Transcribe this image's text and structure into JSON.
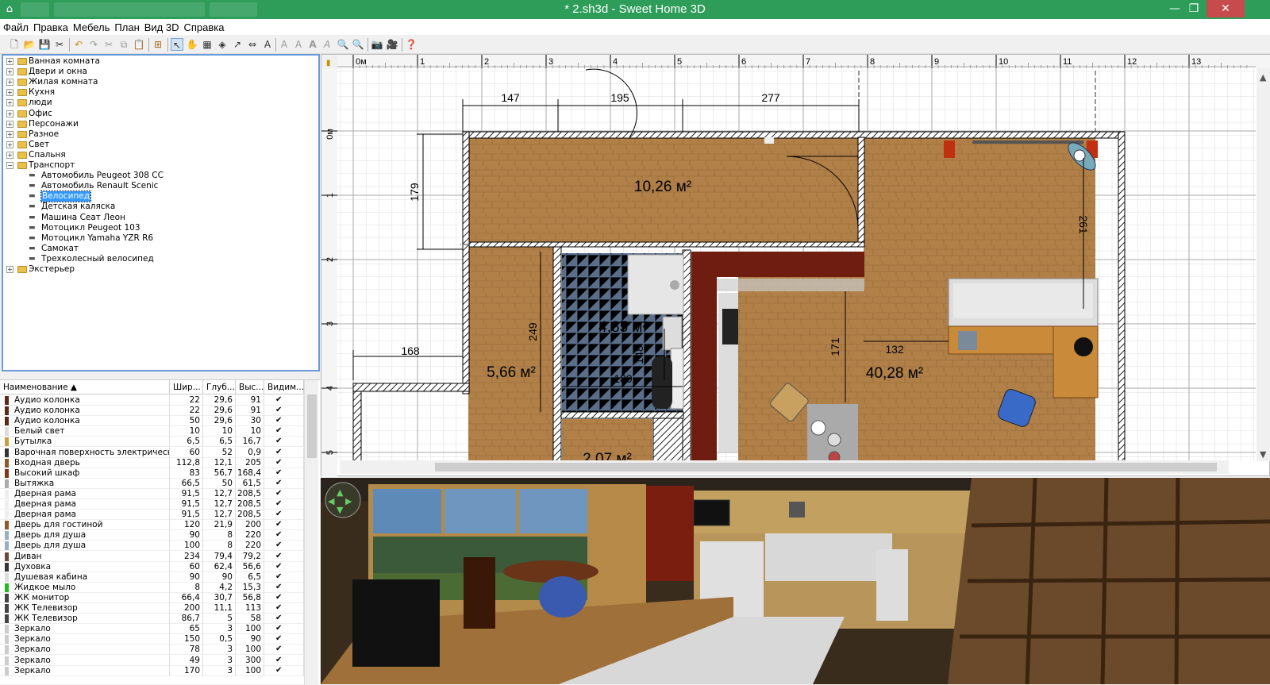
{
  "window": {
    "title": "* 2.sh3d - Sweet Home 3D",
    "controls": [
      "minimize-icon",
      "maximize-icon",
      "close-icon"
    ]
  },
  "menu": [
    "Файл",
    "Правка",
    "Мебель",
    "План",
    "Вид 3D",
    "Справка"
  ],
  "toolbar_icons": [
    "new-icon",
    "open-icon",
    "save-icon",
    "cut-icon",
    "undo-icon",
    "redo-icon",
    "copy-icon",
    "paste-icon",
    "add-furniture-icon",
    "select-icon",
    "pan-icon",
    "create-walls-icon",
    "create-rooms-icon",
    "create-dimensions-icon",
    "create-labels-icon",
    "text-style-icon",
    "zoom-in-icon",
    "zoom-out-icon",
    "create-photo-icon",
    "create-video-icon",
    "help-icon"
  ],
  "catalog": [
    {
      "label": "Ванная комната",
      "type": "folder",
      "expanded": false
    },
    {
      "label": "Двери и окна",
      "type": "folder",
      "expanded": false
    },
    {
      "label": "Жилая комната",
      "type": "folder",
      "expanded": false
    },
    {
      "label": "Кухня",
      "type": "folder",
      "expanded": false
    },
    {
      "label": "люди",
      "type": "folder",
      "expanded": false
    },
    {
      "label": "Офис",
      "type": "folder",
      "expanded": false
    },
    {
      "label": "Персонажи",
      "type": "folder",
      "expanded": false
    },
    {
      "label": "Разное",
      "type": "folder",
      "expanded": false
    },
    {
      "label": "Свет",
      "type": "folder",
      "expanded": false
    },
    {
      "label": "Спальня",
      "type": "folder",
      "expanded": false
    },
    {
      "label": "Транспорт",
      "type": "folder",
      "expanded": true
    },
    {
      "label": "Автомобиль Peugeot 308 CC",
      "type": "item"
    },
    {
      "label": "Автомобиль Renault Scenic",
      "type": "item"
    },
    {
      "label": "Велосипед",
      "type": "item",
      "selected": true
    },
    {
      "label": "Детская каляска",
      "type": "item"
    },
    {
      "label": "Машина Сеат Леон",
      "type": "item"
    },
    {
      "label": "Мотоцикл Peugeot 103",
      "type": "item"
    },
    {
      "label": "Мотоцикл Yamaha YZR R6",
      "type": "item"
    },
    {
      "label": "Самокат",
      "type": "item"
    },
    {
      "label": "Трехколесный велосипед",
      "type": "item"
    },
    {
      "label": "Экстерьер",
      "type": "folder",
      "expanded": false
    }
  ],
  "furniture_headers": [
    "Наименование ▲",
    "Шир...",
    "Глуб...",
    "Выс...",
    "Видим..."
  ],
  "furniture": [
    {
      "name": "Аудио колонка",
      "w": "22",
      "d": "29,6",
      "h": "91",
      "color": "#5a2a1a"
    },
    {
      "name": "Аудио колонка",
      "w": "22",
      "d": "29,6",
      "h": "91",
      "color": "#5a2a1a"
    },
    {
      "name": "Аудио колонка",
      "w": "50",
      "d": "29,6",
      "h": "30",
      "color": "#5a2a1a"
    },
    {
      "name": "Белый свет",
      "w": "10",
      "d": "10",
      "h": "10",
      "color": "#dddddd"
    },
    {
      "name": "Бутылка",
      "w": "6,5",
      "d": "6,5",
      "h": "16,7",
      "color": "#c8a040"
    },
    {
      "name": "Варочная поверхность электрическая",
      "w": "60",
      "d": "52",
      "h": "0,9",
      "color": "#333333"
    },
    {
      "name": "Входная дверь",
      "w": "112,8",
      "d": "12,1",
      "h": "205",
      "color": "#8a5a2a"
    },
    {
      "name": "Высокий шкаф",
      "w": "83",
      "d": "56,7",
      "h": "168,4",
      "color": "#7a3a1a"
    },
    {
      "name": "Вытяжка",
      "w": "66,5",
      "d": "50",
      "h": "61,5",
      "color": "#aaaaaa"
    },
    {
      "name": "Дверная рама",
      "w": "91,5",
      "d": "12,7",
      "h": "208,5",
      "color": "#eeeeee"
    },
    {
      "name": "Дверная рама",
      "w": "91,5",
      "d": "12,7",
      "h": "208,5",
      "color": "#eeeeee"
    },
    {
      "name": "Дверная рама",
      "w": "91,5",
      "d": "12,7",
      "h": "208,5",
      "color": "#eeeeee"
    },
    {
      "name": "Дверь для гостиной",
      "w": "120",
      "d": "21,9",
      "h": "200",
      "color": "#8a5a2a"
    },
    {
      "name": "Дверь для душа",
      "w": "90",
      "d": "8",
      "h": "220",
      "color": "#9ab0c0"
    },
    {
      "name": "Дверь для душа",
      "w": "100",
      "d": "8",
      "h": "220",
      "color": "#9ab0c0"
    },
    {
      "name": "Диван",
      "w": "234",
      "d": "79,4",
      "h": "79,2",
      "color": "#6a4a3a"
    },
    {
      "name": "Духовка",
      "w": "60",
      "d": "62,4",
      "h": "56,6",
      "color": "#333333"
    },
    {
      "name": "Душевая кабина",
      "w": "90",
      "d": "90",
      "h": "6,5",
      "color": "#dddddd"
    },
    {
      "name": "Жидкое мыло",
      "w": "8",
      "d": "4,2",
      "h": "15,3",
      "color": "#22bb22"
    },
    {
      "name": "ЖК монитор",
      "w": "66,4",
      "d": "30,7",
      "h": "56,8",
      "color": "#444444"
    },
    {
      "name": "ЖК Телевизор",
      "w": "200",
      "d": "11,1",
      "h": "113",
      "color": "#444444"
    },
    {
      "name": "ЖК Телевизор",
      "w": "86,7",
      "d": "5",
      "h": "58",
      "color": "#444444"
    },
    {
      "name": "Зеркало",
      "w": "65",
      "d": "3",
      "h": "100",
      "color": "#cccccc"
    },
    {
      "name": "Зеркало",
      "w": "150",
      "d": "0,5",
      "h": "90",
      "color": "#cccccc"
    },
    {
      "name": "Зеркало",
      "w": "78",
      "d": "3",
      "h": "100",
      "color": "#cccccc"
    },
    {
      "name": "Зеркало",
      "w": "49",
      "d": "3",
      "h": "300",
      "color": "#cccccc"
    },
    {
      "name": "Зеркало",
      "w": "170",
      "d": "3",
      "h": "100",
      "color": "#cccccc"
    }
  ],
  "plan": {
    "ruler_top": [
      "0м",
      "1",
      "2",
      "3",
      "4",
      "5",
      "6",
      "7",
      "8",
      "9",
      "10",
      "11",
      "12",
      "13"
    ],
    "ruler_left": [
      "0м",
      "1",
      "2",
      "3",
      "4",
      "5"
    ],
    "dimensions": [
      "147",
      "195",
      "277",
      "179",
      "261",
      "249",
      "171",
      "132",
      "168",
      "148",
      "189"
    ],
    "rooms": [
      {
        "area": "10,26 м²"
      },
      {
        "area": "4,85 м²"
      },
      {
        "area": "5,66 м²"
      },
      {
        "area": "40,28 м²"
      },
      {
        "area": "2,07 м²"
      }
    ]
  },
  "view3d": {
    "navigator": "navigation-arrows-icon"
  }
}
